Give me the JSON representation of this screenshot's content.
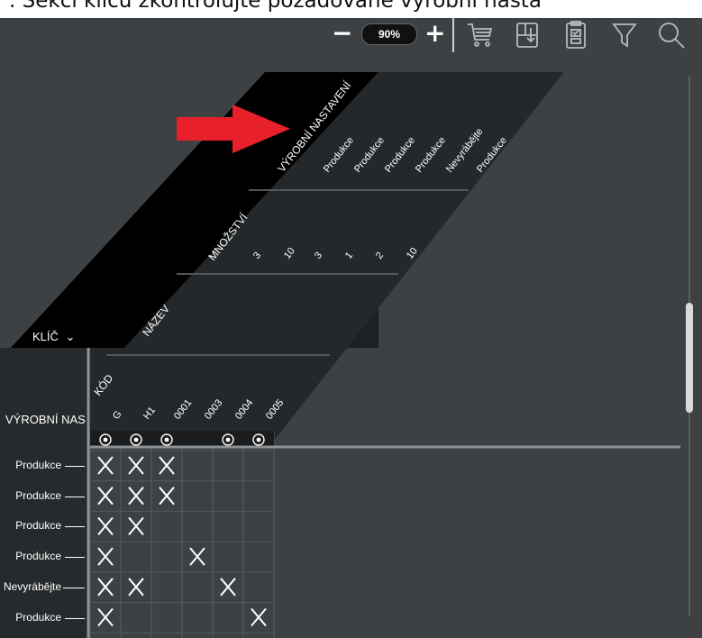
{
  "banner": {
    "text": ". Sekci klíčů zkontrolujte požadované výrobní nasta"
  },
  "toolbar": {
    "zoom": "90%",
    "minus": "−",
    "plus": "+"
  },
  "key_header": {
    "label": "KLÍČ",
    "chevron": "⌄"
  },
  "headers": {
    "production": "VÝROBNÍ NASTAVENÍ",
    "quantity": "MNOŽSTVÍ",
    "name": "NÁZEV",
    "code": "KÓD",
    "row_header": "VÝROBNÍ NAS"
  },
  "columns": [
    {
      "code": "G",
      "quantity": "3",
      "production": "Produkce"
    },
    {
      "code": "H1",
      "quantity": "10",
      "production": "Produkce"
    },
    {
      "code": "0001",
      "quantity": "3",
      "production": "Produkce"
    },
    {
      "code": "0003",
      "quantity": "1",
      "production": "Produkce"
    },
    {
      "code": "0004",
      "quantity": "2",
      "production": "Nevyrábějte"
    },
    {
      "code": "0005",
      "quantity": "10",
      "production": "Produkce"
    }
  ],
  "add_markers": [
    true,
    true,
    true,
    false,
    true,
    true
  ],
  "rows": [
    {
      "label": "Produkce",
      "marks": [
        true,
        true,
        true,
        false,
        false,
        false,
        false
      ]
    },
    {
      "label": "Produkce",
      "marks": [
        true,
        true,
        true,
        false,
        false,
        false,
        false
      ]
    },
    {
      "label": "Produkce",
      "marks": [
        true,
        true,
        false,
        false,
        false,
        false,
        false
      ]
    },
    {
      "label": "Produkce",
      "marks": [
        true,
        false,
        false,
        true,
        false,
        false,
        false
      ]
    },
    {
      "label": "Nevyrábějte",
      "marks": [
        true,
        true,
        false,
        false,
        true,
        false,
        false
      ]
    },
    {
      "label": "Produkce",
      "marks": [
        true,
        false,
        false,
        false,
        false,
        true,
        false
      ]
    }
  ],
  "colors": {
    "background": "#3d4143",
    "header": "#000000",
    "grid": "#2a2d2f",
    "arrow": "#e8202a"
  },
  "icons": [
    "cart-icon",
    "export-icon",
    "clipboard-icon",
    "filter-icon",
    "search-icon"
  ]
}
